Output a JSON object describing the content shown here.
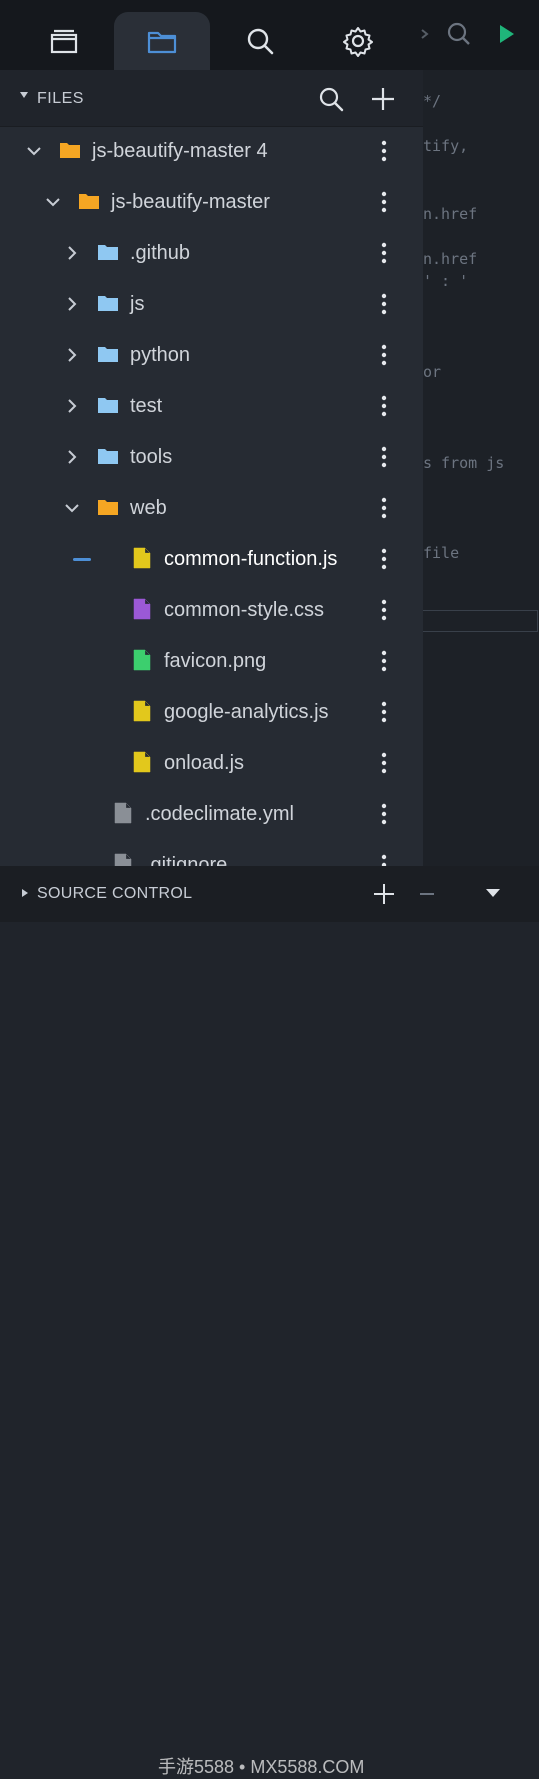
{
  "top_tabs": [
    {
      "name": "editors",
      "icon": "stack-icon"
    },
    {
      "name": "files",
      "icon": "folder-icon",
      "active": true
    },
    {
      "name": "search",
      "icon": "search-icon"
    },
    {
      "name": "settings",
      "icon": "gear-icon"
    }
  ],
  "panel": {
    "title": "FILES"
  },
  "tree": [
    {
      "label": "js-beautify-master 4",
      "type": "folder",
      "expanded": true,
      "color": "#f5a623"
    },
    {
      "label": "js-beautify-master",
      "type": "folder",
      "expanded": true,
      "color": "#f5a623"
    },
    {
      "label": ".github",
      "type": "folder",
      "expanded": false,
      "color": "#8fc8f2"
    },
    {
      "label": "js",
      "type": "folder",
      "expanded": false,
      "color": "#8fc8f2"
    },
    {
      "label": "python",
      "type": "folder",
      "expanded": false,
      "color": "#8fc8f2"
    },
    {
      "label": "test",
      "type": "folder",
      "expanded": false,
      "color": "#8fc8f2"
    },
    {
      "label": "tools",
      "type": "folder",
      "expanded": false,
      "color": "#8fc8f2"
    },
    {
      "label": "web",
      "type": "folder",
      "expanded": true,
      "color": "#f5a623"
    },
    {
      "label": "common-function.js",
      "type": "file",
      "color": "#e2c81c",
      "active": true
    },
    {
      "label": "common-style.css",
      "type": "file",
      "color": "#9b59d6"
    },
    {
      "label": "favicon.png",
      "type": "file",
      "color": "#3ccf6e"
    },
    {
      "label": "google-analytics.js",
      "type": "file",
      "color": "#e2c81c"
    },
    {
      "label": "onload.js",
      "type": "file",
      "color": "#e2c81c"
    },
    {
      "label": ".codeclimate.yml",
      "type": "file",
      "color": "#8a8f96"
    },
    {
      "label": ".gitignore",
      "type": "file",
      "color": "#8a8f96"
    }
  ],
  "editor_code": [
    {
      "text": "*/"
    },
    {
      "text": "tify,"
    },
    {
      "text": "n.href"
    },
    {
      "text": "n.href"
    },
    {
      "text": "' : '"
    },
    {
      "text": "or"
    },
    {
      "text": "s from js"
    },
    {
      "text": "file"
    }
  ],
  "source_control": {
    "label": "SOURCE CONTROL"
  },
  "watermark": "手游5588 • MX5588.COM",
  "colors": {
    "accent": "#4d8fd6",
    "run": "#1fb57a"
  }
}
